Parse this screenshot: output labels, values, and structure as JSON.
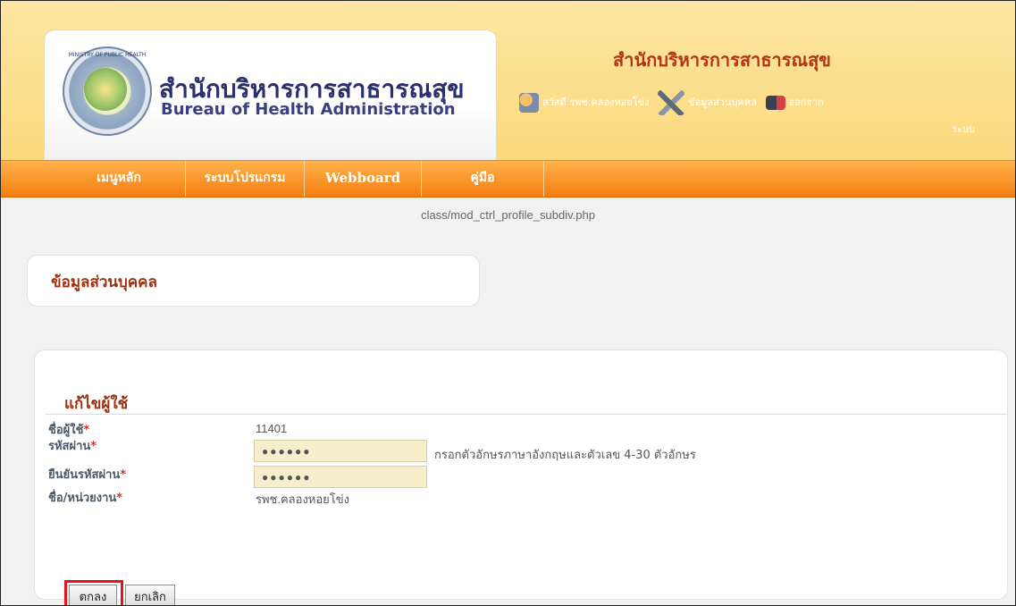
{
  "header": {
    "logo_thai": "สำนักบริหารการสาธารณสุข",
    "logo_english": "Bureau of Health Administration",
    "seal_text": "MINISTRY OF PUBLIC HEALTH",
    "title": "สำนักบริหารการสาธารณสุข",
    "greeting": "สวัสดี รพช.คลองหอยโข่ง",
    "profile_link": "ข้อมูลส่วนบุคคล",
    "logout_link": "ออกจาก",
    "logout_link_cont": "ระบบ"
  },
  "nav": {
    "items": [
      "เมนูหลัก",
      "ระบบโปรแกรม",
      "Webboard",
      "คู่มือ"
    ]
  },
  "path": "class/mod_ctrl_profile_subdiv.php",
  "profile": {
    "title": "ข้อมูลส่วนบุคคล"
  },
  "form": {
    "title": "แก้ไขผู้ใช้",
    "fields": {
      "username_label": "ชื่อผู้ใช้",
      "username_value": "11401",
      "password_label": "รหัสผ่าน",
      "password_value": "●●●●●●",
      "password_hint": "กรอกตัวอักษรภาษาอังกฤษและตัวเลข 4-30 ตัวอักษร",
      "confirm_label": "ยืนยันรหัสผ่าน",
      "confirm_value": "●●●●●●",
      "unit_label": "ชื่อ/หน่วยงาน",
      "unit_value": "รพช.คลองหอยโข่ง",
      "required_mark": "*"
    },
    "buttons": {
      "ok": "ตกลง",
      "cancel": "ยกเลิก"
    }
  },
  "colors": {
    "header_bg": "#fbd97d",
    "nav_orange": "#f47e10",
    "title_red": "#b3350f",
    "highlight_red": "#e5141b"
  }
}
